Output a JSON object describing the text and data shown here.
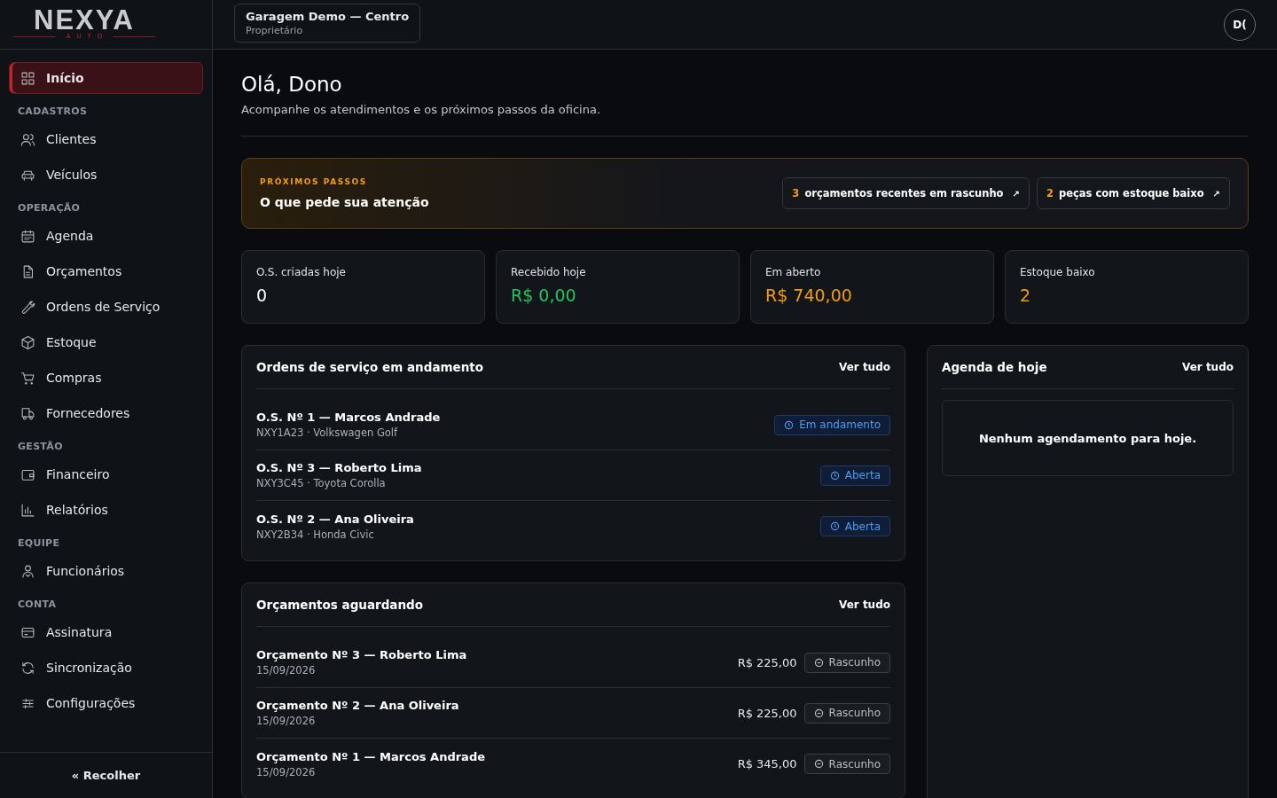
{
  "logo": {
    "name": "NEXYA",
    "tagline": "AUTO"
  },
  "workspace": {
    "name": "Garagem Demo — Centro",
    "role": "Proprietário"
  },
  "avatar": {
    "initials": "D("
  },
  "sidebar": {
    "items": [
      {
        "kind": "link",
        "label": "Início",
        "selected": true
      },
      {
        "kind": "section",
        "label": "CADASTROS"
      },
      {
        "kind": "link",
        "label": "Clientes",
        "selected": false
      },
      {
        "kind": "link",
        "label": "Veículos",
        "selected": false
      },
      {
        "kind": "section",
        "label": "OPERAÇÃO"
      },
      {
        "kind": "link",
        "label": "Agenda",
        "selected": false
      },
      {
        "kind": "link",
        "label": "Orçamentos",
        "selected": false
      },
      {
        "kind": "link",
        "label": "Ordens de Serviço",
        "selected": false
      },
      {
        "kind": "link",
        "label": "Estoque",
        "selected": false
      },
      {
        "kind": "link",
        "label": "Compras",
        "selected": false
      },
      {
        "kind": "link",
        "label": "Fornecedores",
        "selected": false
      },
      {
        "kind": "section",
        "label": "GESTÃO"
      },
      {
        "kind": "link",
        "label": "Financeiro",
        "selected": false
      },
      {
        "kind": "link",
        "label": "Relatórios",
        "selected": false
      },
      {
        "kind": "section",
        "label": "EQUIPE"
      },
      {
        "kind": "link",
        "label": "Funcionários",
        "selected": false
      },
      {
        "kind": "section",
        "label": "CONTA"
      },
      {
        "kind": "link",
        "label": "Assinatura",
        "selected": false
      },
      {
        "kind": "link",
        "label": "Sincronização",
        "selected": false
      },
      {
        "kind": "link",
        "label": "Configurações",
        "selected": false
      }
    ],
    "collapse": "« Recolher"
  },
  "greeting": {
    "title": "Olá, Dono",
    "subtitle": "Acompanhe os atendimentos e os próximos passos da oficina."
  },
  "next_steps": {
    "eyebrow": "PRÓXIMOS PASSOS",
    "title": "O que pede sua atenção",
    "actions": [
      {
        "count": "3",
        "label": "orçamentos recentes em rascunho",
        "arrow": "↗"
      },
      {
        "count": "2",
        "label": "peças com estoque baixo",
        "arrow": "↗"
      }
    ]
  },
  "stats": [
    {
      "label": "O.S. criadas hoje",
      "value": "0",
      "color": "#ffffff"
    },
    {
      "label": "Recebido hoje",
      "value": "R$ 0,00",
      "color": "#22c55e"
    },
    {
      "label": "Em aberto",
      "value": "R$ 740,00",
      "color": "#f59e0b"
    },
    {
      "label": "Estoque baixo",
      "value": "2",
      "color": "#f59e0b"
    }
  ],
  "service_orders": {
    "title": "Ordens de serviço em andamento",
    "link": "Ver tudo",
    "rows": [
      {
        "title": "O.S. Nº 1 — Marcos Andrade",
        "subtitle": "NXY1A23 · Volkswagen Golf",
        "status": "Em andamento",
        "kind": "active"
      },
      {
        "title": "O.S. Nº 3 — Roberto Lima",
        "subtitle": "NXY3C45 · Toyota Corolla",
        "status": "Aberta",
        "kind": "active"
      },
      {
        "title": "O.S. Nº 2 — Ana Oliveira",
        "subtitle": "NXY2B34 · Honda Civic",
        "status": "Aberta",
        "kind": "active"
      }
    ]
  },
  "quotes": {
    "title": "Orçamentos aguardando",
    "link": "Ver tudo",
    "rows": [
      {
        "title": "Orçamento Nº 3 — Roberto Lima",
        "subtitle": "15/09/2026",
        "amount": "R$ 225,00",
        "status": "Rascunho",
        "kind": "draft"
      },
      {
        "title": "Orçamento Nº 2 — Ana Oliveira",
        "subtitle": "15/09/2026",
        "amount": "R$ 225,00",
        "status": "Rascunho",
        "kind": "draft"
      },
      {
        "title": "Orçamento Nº 1 — Marcos Andrade",
        "subtitle": "15/09/2026",
        "amount": "R$ 345,00",
        "status": "Rascunho",
        "kind": "draft"
      }
    ]
  },
  "agenda": {
    "title": "Agenda de hoje",
    "link": "Ver tudo",
    "empty": "Nenhum agendamento para hoje."
  }
}
